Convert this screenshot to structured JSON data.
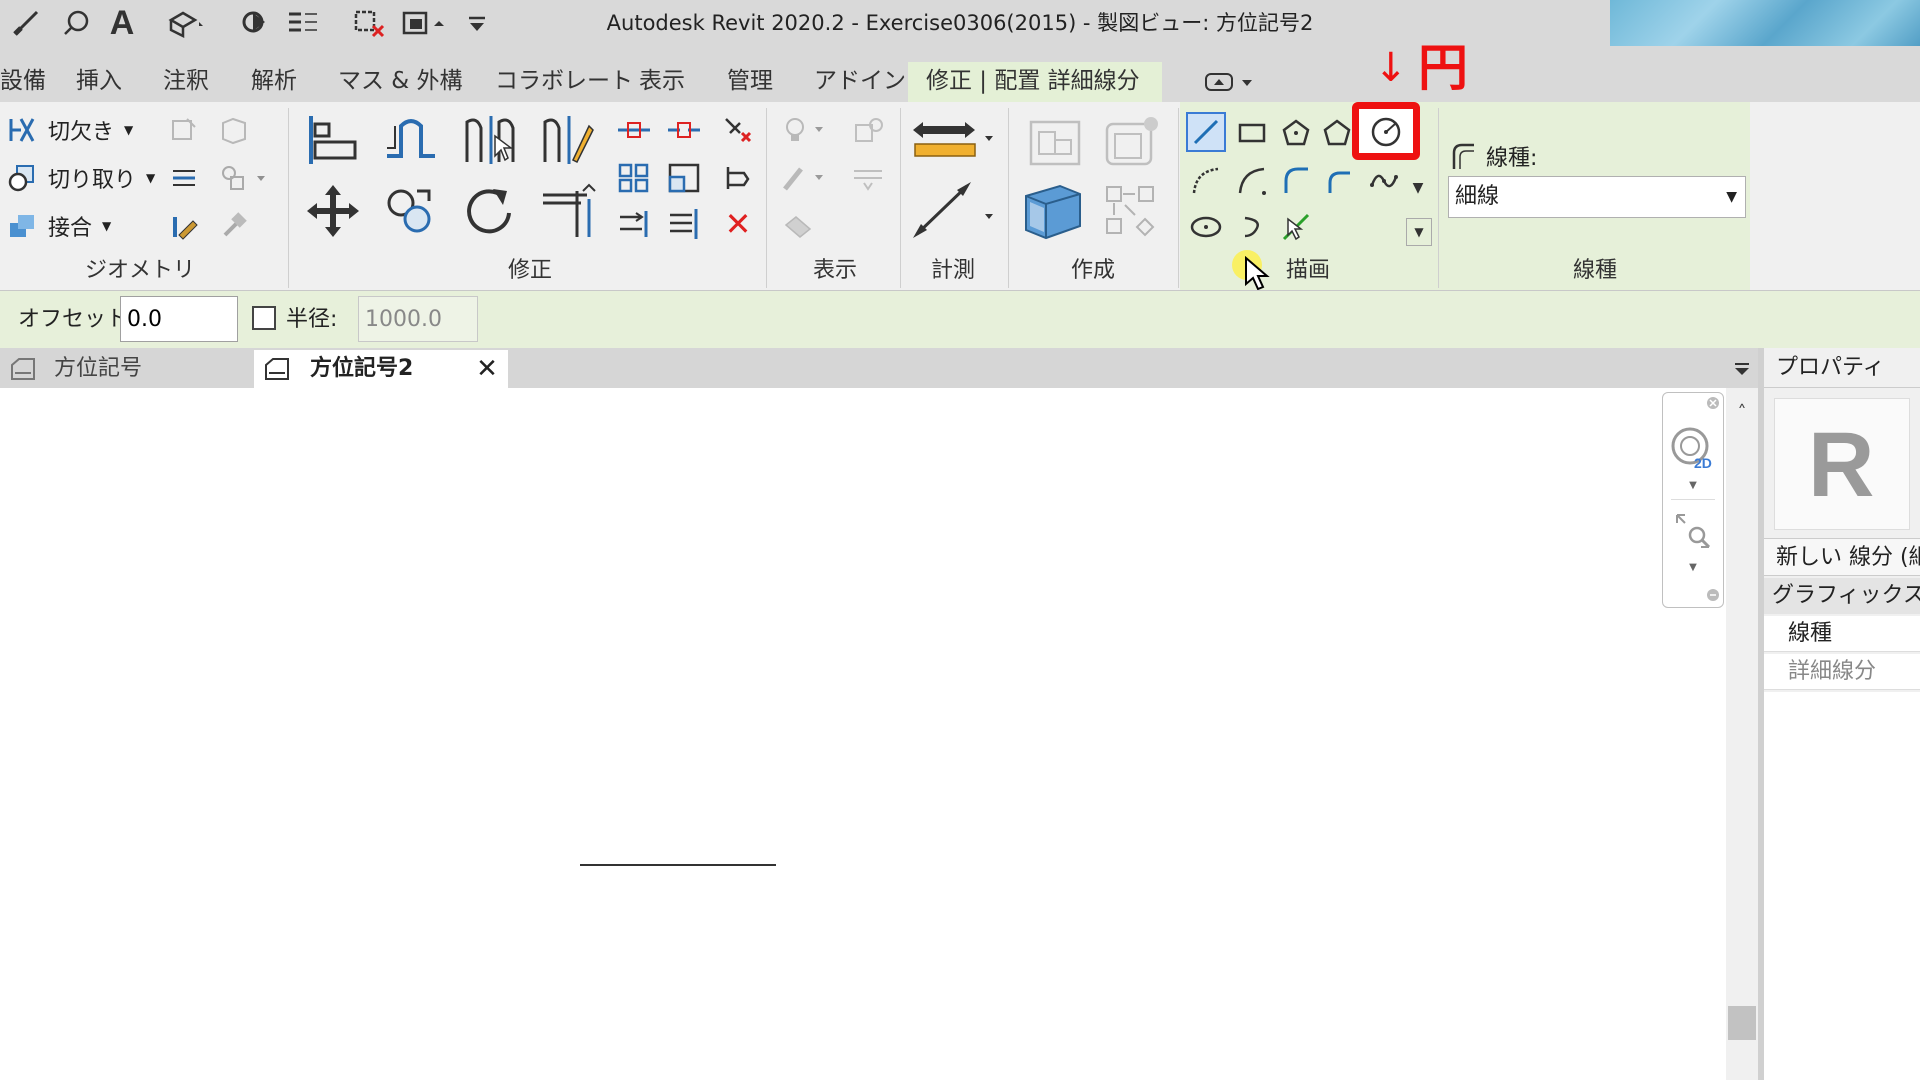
{
  "window": {
    "title": "Autodesk Revit 2020.2 - Exercise0306(2015) - 製図ビュー: 方位記号2"
  },
  "ribbon_tabs": [
    "設備",
    "挿入",
    "注釈",
    "解析",
    "マス & 外構",
    "コラボレート",
    "表示",
    "管理",
    "アドイン",
    "修正 | 配置 詳細線分"
  ],
  "geometry_panel": {
    "cope_label": "切欠き",
    "cut_label": "切り取り",
    "join_label": "接合",
    "panel_label": "ジオメトリ"
  },
  "panel_labels": {
    "modify": "修正",
    "view": "表示",
    "measure": "計測",
    "create": "作成",
    "draw": "描画",
    "linestyle": "線種"
  },
  "annotation": {
    "arrow": "↓",
    "label": "円"
  },
  "linestyle": {
    "field_label": "線種:",
    "selected": "細線"
  },
  "options_bar": {
    "offset_label": "オフセット:",
    "offset_value": "0.0",
    "radius_label": "半径:",
    "radius_value": "1000.0"
  },
  "view_tabs": [
    {
      "label": "方位記号"
    },
    {
      "label": "方位記号2"
    }
  ],
  "properties": {
    "header": "プロパティ",
    "type_name": "新しい 線分 (細",
    "graphics_header": "グラフィックス",
    "param_label": "線種",
    "param_value": "詳細線分"
  },
  "colors": {
    "ribbon_bg": "#f0f0f0",
    "contextual_tab_bg": "#e4f0d6",
    "highlight_red": "#ee1111",
    "accent_blue": "#1f6fb5"
  }
}
